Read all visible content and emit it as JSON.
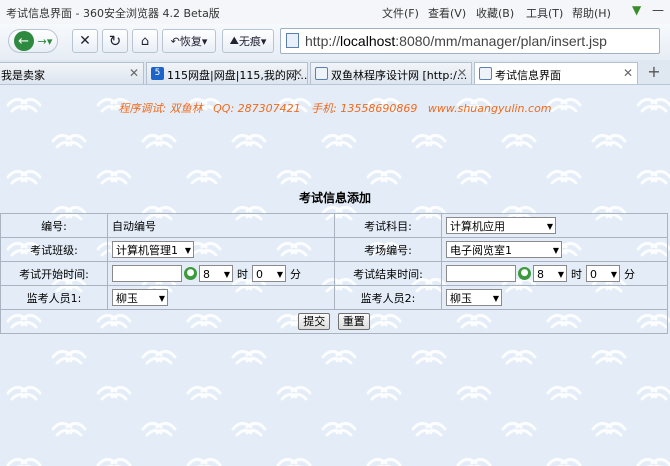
{
  "window": {
    "title": "考试信息界面 - 360安全浏览器 4.2 Beta版"
  },
  "menu": [
    "文件(F)",
    "查看(V)",
    "收藏(B)",
    "工具(T)",
    "帮助(H)"
  ],
  "toolbar": {
    "restore_label": "恢复",
    "notrace_label": "无痕"
  },
  "address": {
    "host": "localhost",
    "url_prefix": "http://",
    "url_rest": ":8080/mm/manager/plan/insert.jsp"
  },
  "tabs": [
    {
      "label": "我是卖家"
    },
    {
      "label": "115网盘|网盘|115,我的网..."
    },
    {
      "label": "双鱼林程序设计网 [http:/..."
    },
    {
      "label": "考试信息界面"
    }
  ],
  "credits": "程序调试: 双鱼林   QQ: 287307421   手机: 13558690869   www.shuangyulin.com",
  "form": {
    "title": "考试信息添加",
    "id_label": "编号:",
    "id_value": "自动编号",
    "subject_label": "考试科目:",
    "subject_value": "计算机应用",
    "class_label": "考试班级:",
    "class_value": "计算机管理1",
    "room_label": "考场编号:",
    "room_value": "电子阅览室1",
    "start_label": "考试开始时间:",
    "start_hour": "8",
    "start_minute": "0",
    "end_label": "考试结束时间:",
    "end_hour": "8",
    "end_minute": "0",
    "hour_unit": "时",
    "minute_unit": "分",
    "proctor1_label": "监考人员1:",
    "proctor1_value": "柳玉",
    "proctor2_label": "监考人员2:",
    "proctor2_value": "柳玉",
    "submit_label": "提交",
    "reset_label": "重置"
  }
}
